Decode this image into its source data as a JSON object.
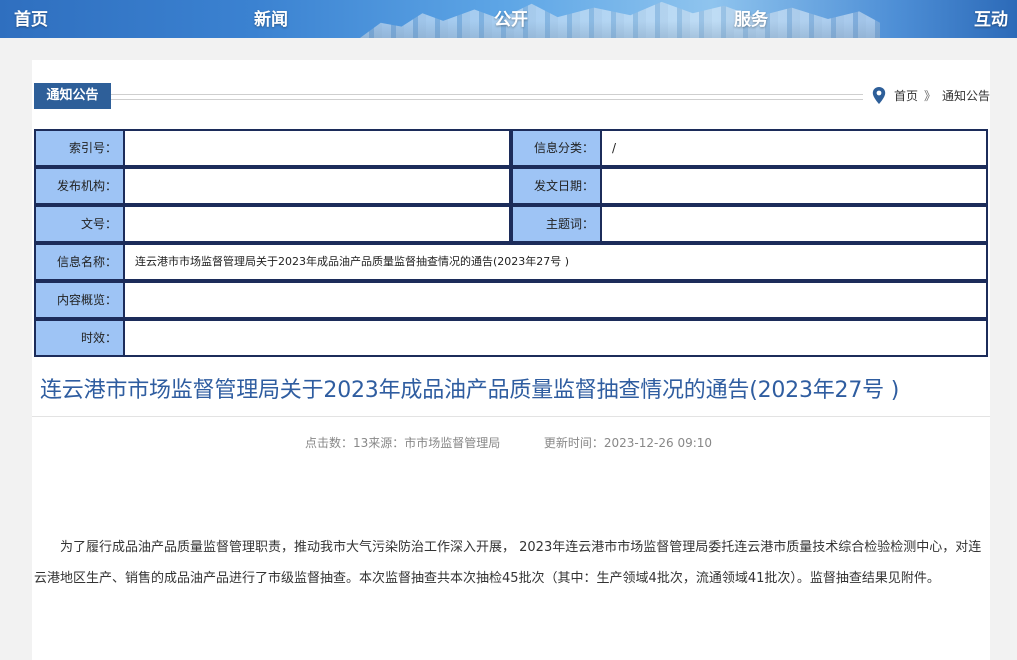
{
  "nav": {
    "items": [
      "首页",
      "新闻",
      "公开",
      "服务",
      "互动"
    ]
  },
  "section": {
    "tag": "通知公告"
  },
  "breadcrumb": {
    "home": "首页",
    "separator": "》",
    "current": "通知公告"
  },
  "info": {
    "index_label": "索引号：",
    "index_value": "",
    "category_label": "信息分类：",
    "category_value": "/",
    "org_label": "发布机构：",
    "org_value": "",
    "date_label": "发文日期：",
    "date_value": "",
    "docno_label": "文号：",
    "docno_value": "",
    "subject_label": "主题词：",
    "subject_value": "",
    "name_label": "信息名称：",
    "name_value": "连云港市市场监督管理局关于2023年成品油产品质量监督抽查情况的通告(2023年27号 )",
    "summary_label": "内容概览：",
    "summary_value": "",
    "validity_label": "时效：",
    "validity_value": ""
  },
  "article": {
    "title": "连云港市市场监督管理局关于2023年成品油产品质量监督抽查情况的通告(2023年27号 )",
    "meta_source": "点击数：13来源：市市场监督管理局",
    "meta_updated": "更新时间：2023-12-26 09:10",
    "body": "为了履行成品油产品质量监督管理职责，推动我市大气污染防治工作深入开展， 2023年连云港市市场监督管理局委托连云港市质量技术综合检验检测中心，对连云港地区生产、销售的成品油产品进行了市级监督抽查。本次监督抽查共本次抽检45批次（其中：生产领域4批次，流通领域41批次）。监督抽查结果见附件。"
  },
  "colors": {
    "label_bg": "#9ec4f5",
    "border": "#1c2c5a",
    "title": "#2f5da0",
    "tag_bg": "#2e5f99"
  }
}
